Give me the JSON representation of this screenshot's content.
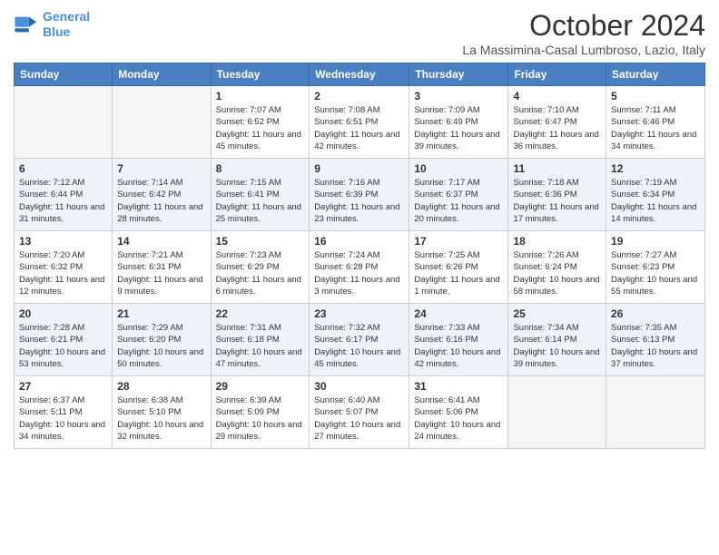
{
  "logo": {
    "line1": "General",
    "line2": "Blue"
  },
  "title": "October 2024",
  "subtitle": "La Massimina-Casal Lumbroso, Lazio, Italy",
  "days_of_week": [
    "Sunday",
    "Monday",
    "Tuesday",
    "Wednesday",
    "Thursday",
    "Friday",
    "Saturday"
  ],
  "weeks": [
    [
      {
        "day": "",
        "info": ""
      },
      {
        "day": "",
        "info": ""
      },
      {
        "day": "1",
        "info": "Sunrise: 7:07 AM\nSunset: 6:52 PM\nDaylight: 11 hours and 45 minutes."
      },
      {
        "day": "2",
        "info": "Sunrise: 7:08 AM\nSunset: 6:51 PM\nDaylight: 11 hours and 42 minutes."
      },
      {
        "day": "3",
        "info": "Sunrise: 7:09 AM\nSunset: 6:49 PM\nDaylight: 11 hours and 39 minutes."
      },
      {
        "day": "4",
        "info": "Sunrise: 7:10 AM\nSunset: 6:47 PM\nDaylight: 11 hours and 36 minutes."
      },
      {
        "day": "5",
        "info": "Sunrise: 7:11 AM\nSunset: 6:46 PM\nDaylight: 11 hours and 34 minutes."
      }
    ],
    [
      {
        "day": "6",
        "info": "Sunrise: 7:12 AM\nSunset: 6:44 PM\nDaylight: 11 hours and 31 minutes."
      },
      {
        "day": "7",
        "info": "Sunrise: 7:14 AM\nSunset: 6:42 PM\nDaylight: 11 hours and 28 minutes."
      },
      {
        "day": "8",
        "info": "Sunrise: 7:15 AM\nSunset: 6:41 PM\nDaylight: 11 hours and 25 minutes."
      },
      {
        "day": "9",
        "info": "Sunrise: 7:16 AM\nSunset: 6:39 PM\nDaylight: 11 hours and 23 minutes."
      },
      {
        "day": "10",
        "info": "Sunrise: 7:17 AM\nSunset: 6:37 PM\nDaylight: 11 hours and 20 minutes."
      },
      {
        "day": "11",
        "info": "Sunrise: 7:18 AM\nSunset: 6:36 PM\nDaylight: 11 hours and 17 minutes."
      },
      {
        "day": "12",
        "info": "Sunrise: 7:19 AM\nSunset: 6:34 PM\nDaylight: 11 hours and 14 minutes."
      }
    ],
    [
      {
        "day": "13",
        "info": "Sunrise: 7:20 AM\nSunset: 6:32 PM\nDaylight: 11 hours and 12 minutes."
      },
      {
        "day": "14",
        "info": "Sunrise: 7:21 AM\nSunset: 6:31 PM\nDaylight: 11 hours and 9 minutes."
      },
      {
        "day": "15",
        "info": "Sunrise: 7:23 AM\nSunset: 6:29 PM\nDaylight: 11 hours and 6 minutes."
      },
      {
        "day": "16",
        "info": "Sunrise: 7:24 AM\nSunset: 6:28 PM\nDaylight: 11 hours and 3 minutes."
      },
      {
        "day": "17",
        "info": "Sunrise: 7:25 AM\nSunset: 6:26 PM\nDaylight: 11 hours and 1 minute."
      },
      {
        "day": "18",
        "info": "Sunrise: 7:26 AM\nSunset: 6:24 PM\nDaylight: 10 hours and 58 minutes."
      },
      {
        "day": "19",
        "info": "Sunrise: 7:27 AM\nSunset: 6:23 PM\nDaylight: 10 hours and 55 minutes."
      }
    ],
    [
      {
        "day": "20",
        "info": "Sunrise: 7:28 AM\nSunset: 6:21 PM\nDaylight: 10 hours and 53 minutes."
      },
      {
        "day": "21",
        "info": "Sunrise: 7:29 AM\nSunset: 6:20 PM\nDaylight: 10 hours and 50 minutes."
      },
      {
        "day": "22",
        "info": "Sunrise: 7:31 AM\nSunset: 6:18 PM\nDaylight: 10 hours and 47 minutes."
      },
      {
        "day": "23",
        "info": "Sunrise: 7:32 AM\nSunset: 6:17 PM\nDaylight: 10 hours and 45 minutes."
      },
      {
        "day": "24",
        "info": "Sunrise: 7:33 AM\nSunset: 6:16 PM\nDaylight: 10 hours and 42 minutes."
      },
      {
        "day": "25",
        "info": "Sunrise: 7:34 AM\nSunset: 6:14 PM\nDaylight: 10 hours and 39 minutes."
      },
      {
        "day": "26",
        "info": "Sunrise: 7:35 AM\nSunset: 6:13 PM\nDaylight: 10 hours and 37 minutes."
      }
    ],
    [
      {
        "day": "27",
        "info": "Sunrise: 6:37 AM\nSunset: 5:11 PM\nDaylight: 10 hours and 34 minutes."
      },
      {
        "day": "28",
        "info": "Sunrise: 6:38 AM\nSunset: 5:10 PM\nDaylight: 10 hours and 32 minutes."
      },
      {
        "day": "29",
        "info": "Sunrise: 6:39 AM\nSunset: 5:09 PM\nDaylight: 10 hours and 29 minutes."
      },
      {
        "day": "30",
        "info": "Sunrise: 6:40 AM\nSunset: 5:07 PM\nDaylight: 10 hours and 27 minutes."
      },
      {
        "day": "31",
        "info": "Sunrise: 6:41 AM\nSunset: 5:06 PM\nDaylight: 10 hours and 24 minutes."
      },
      {
        "day": "",
        "info": ""
      },
      {
        "day": "",
        "info": ""
      }
    ]
  ]
}
